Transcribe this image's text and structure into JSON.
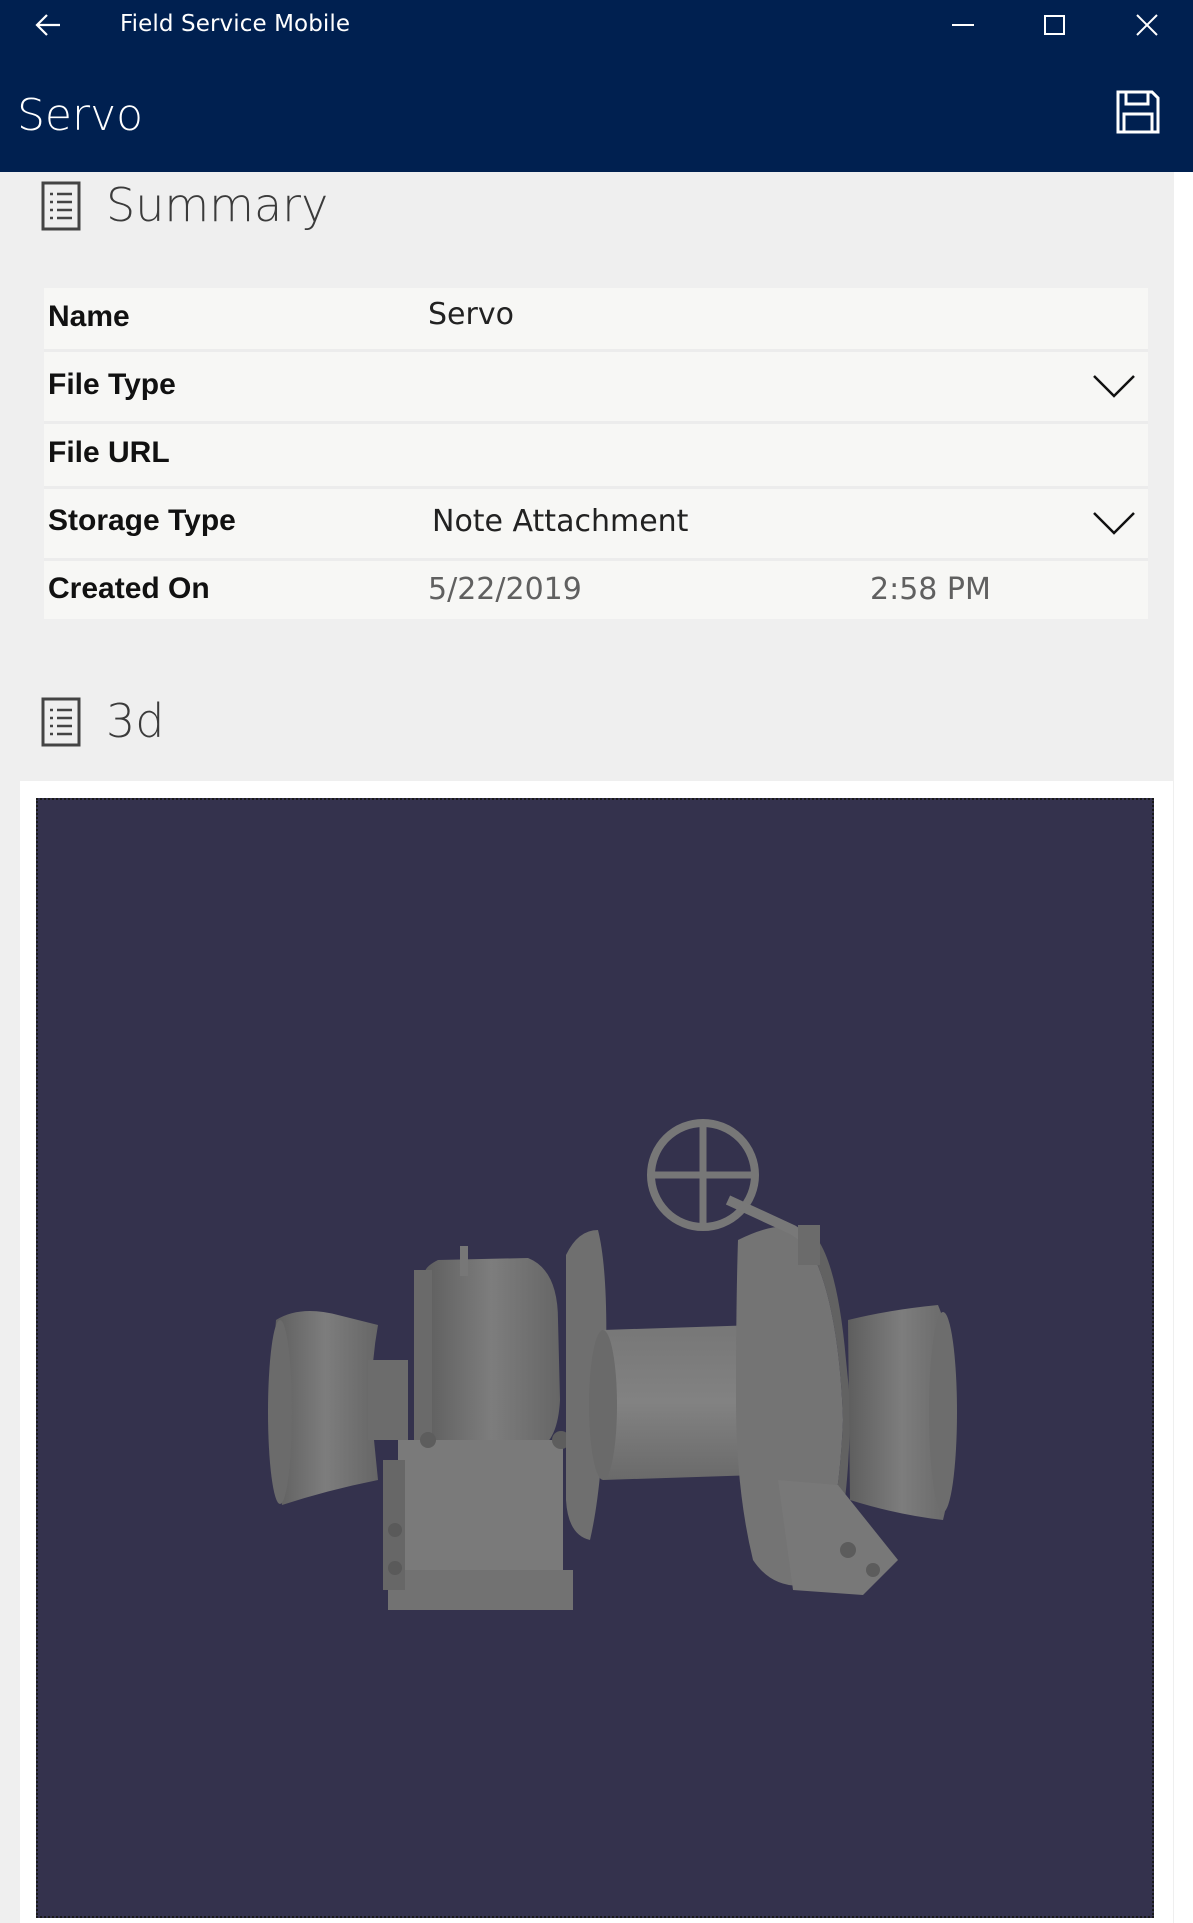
{
  "window": {
    "app_title": "Field Service Mobile",
    "back_icon": "arrow-left-icon",
    "minimize_icon": "minimize-icon",
    "maximize_icon": "maximize-icon",
    "close_icon": "close-icon"
  },
  "header": {
    "title": "Servo",
    "save_icon": "floppy-disk-icon",
    "background": "#002050"
  },
  "summary": {
    "title": "Summary",
    "icon": "document-list-icon",
    "fields": [
      {
        "label": "Name",
        "value": "Servo"
      },
      {
        "label": "File Type",
        "value": "",
        "dropdown": true
      },
      {
        "label": "File URL",
        "value": ""
      },
      {
        "label": "Storage Type",
        "value": "Note Attachment",
        "dropdown": true
      },
      {
        "label": "Created On",
        "date": "5/22/2019",
        "time": "2:58 PM"
      }
    ]
  },
  "viewer_section": {
    "title": "3d",
    "icon": "document-list-icon",
    "background": "#34324d",
    "model_color": "#7a7a7a",
    "model": "winch-3d-model"
  }
}
